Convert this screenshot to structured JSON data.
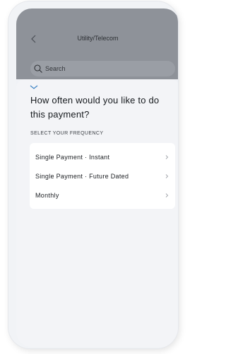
{
  "header": {
    "title": "Utility/Telecom"
  },
  "search": {
    "placeholder": "Search"
  },
  "sheet": {
    "question": "How often would you like to do this payment?",
    "section_label": "SELECT YOUR FREQUENCY",
    "options": [
      {
        "label": "Single Payment · Instant"
      },
      {
        "label": "Single Payment · Future Dated"
      },
      {
        "label": "Monthly"
      }
    ]
  },
  "colors": {
    "overlay": "#8e9299",
    "sheet": "#f3f4f7",
    "accent": "#3b82c4"
  },
  "icons": {
    "back": "chevron-left-icon",
    "search": "search-icon",
    "collapse": "chevron-down-icon",
    "option_arrow": "chevron-right-icon"
  }
}
